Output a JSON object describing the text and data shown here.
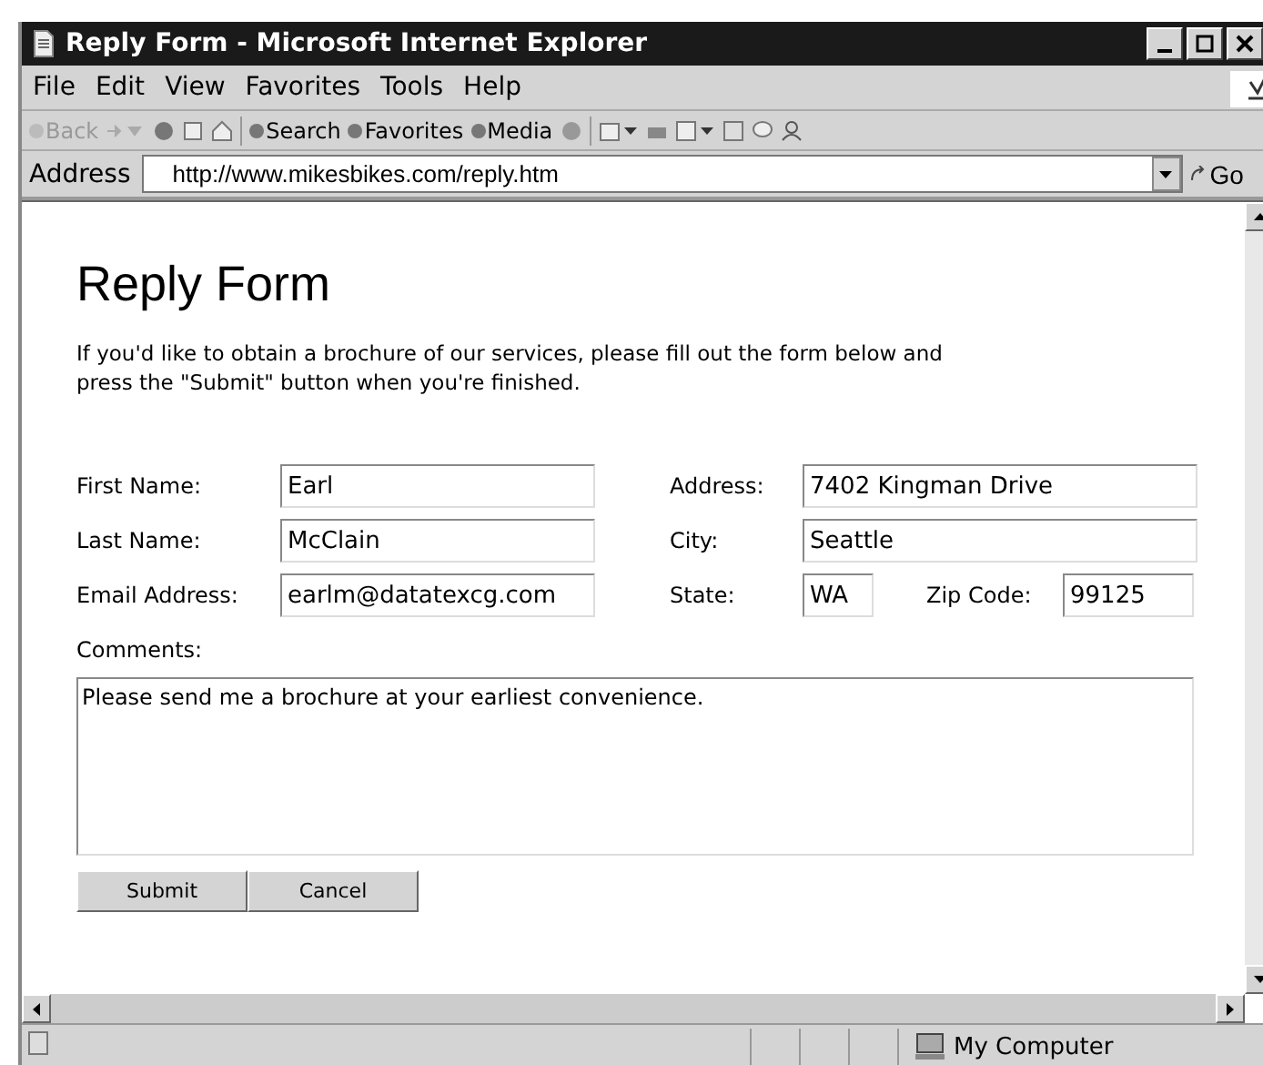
{
  "window": {
    "title": "Reply Form - Microsoft Internet Explorer"
  },
  "menu": [
    "File",
    "Edit",
    "View",
    "Favorites",
    "Tools",
    "Help"
  ],
  "toolbar": [
    {
      "label": "Back",
      "disabled": true
    },
    {
      "label": "Search",
      "disabled": false
    },
    {
      "label": "Favorites",
      "disabled": false
    },
    {
      "label": "Media",
      "disabled": false
    }
  ],
  "address": {
    "label": "Address",
    "value": "http://www.mikesbikes.com/reply.htm",
    "go": "Go"
  },
  "page": {
    "heading": "Reply Form",
    "intro": "If you'd like to obtain a brochure of our services, please fill out the form below and press the \"Submit\" button when you're finished.",
    "rows": [
      {
        "left": {
          "label": "First Name:",
          "value": "Earl"
        },
        "right": [
          {
            "label": "Address:",
            "value": "7402 Kingman Drive"
          }
        ]
      },
      {
        "left": {
          "label": "Last Name:",
          "value": "McClain"
        },
        "right": [
          {
            "label": "City:",
            "value": "Seattle"
          }
        ]
      },
      {
        "left": {
          "label": "Email Address:",
          "value": "earlm@datatexcg.com"
        },
        "right": [
          {
            "label": "State:",
            "value": "WA"
          },
          {
            "label": "Zip Code:",
            "value": "99125"
          }
        ]
      }
    ],
    "comments": {
      "label": "Comments:",
      "value": "Please send me a brochure at your earliest convenience."
    },
    "buttons": [
      "Submit",
      "Cancel"
    ]
  },
  "status_bar": {
    "zone": "My Computer"
  }
}
